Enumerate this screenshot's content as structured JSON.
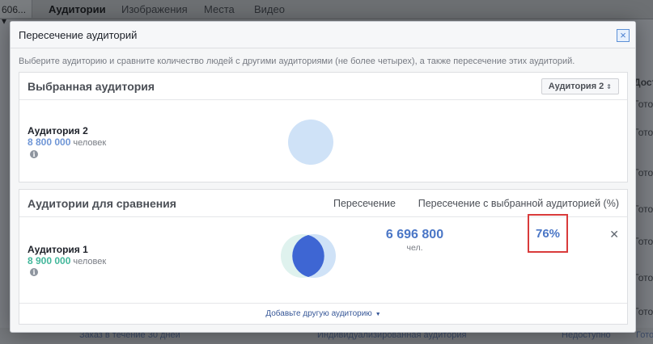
{
  "background": {
    "account_label": "606...",
    "tabs": [
      "Аудитории",
      "Изображения",
      "Места",
      "Видео"
    ],
    "right_column": {
      "header": "Доступ",
      "cells": [
        "Готов",
        "Готов",
        "Готов",
        "Готов",
        "Готов",
        "Готов",
        "Готов"
      ]
    },
    "bottom_row": {
      "name": "Заказ в течение 30 дней",
      "type": "Индивидуализированная аудитория",
      "status": "Недоступно",
      "status2": "Готов"
    }
  },
  "dialog": {
    "title": "Пересечение аудиторий",
    "description": "Выберите аудиторию и сравните количество людей с другими аудиториями (не более четырех), а также пересечение этих аудиторий.",
    "selected_panel": {
      "title": "Выбранная аудитория",
      "select_value": "Аудитория 2",
      "audience_name": "Аудитория 2",
      "audience_size": "8 800 000",
      "size_unit": "человек",
      "info_icon": "info-icon"
    },
    "compare_panel": {
      "title": "Аудитории для сравнения",
      "col_overlap": "Пересечение",
      "col_overlap_pct": "Пересечение с выбранной аудиторией (%)",
      "rows": [
        {
          "name": "Аудитория 1",
          "size": "8 900 000",
          "size_unit": "человек",
          "overlap": "6 696 800",
          "overlap_unit": "чел.",
          "overlap_pct": "76%"
        }
      ],
      "add_link": "Добавьте другую аудиторию",
      "remove_icon": "close-icon"
    }
  },
  "colors": {
    "selected_size": "#6f96d6",
    "compare_size": "#42b79b",
    "number_blue": "#4a76c6",
    "highlight": "#d93b3b",
    "circle_light": "#cfe2f7",
    "circle_dark": "#3e66d3"
  }
}
